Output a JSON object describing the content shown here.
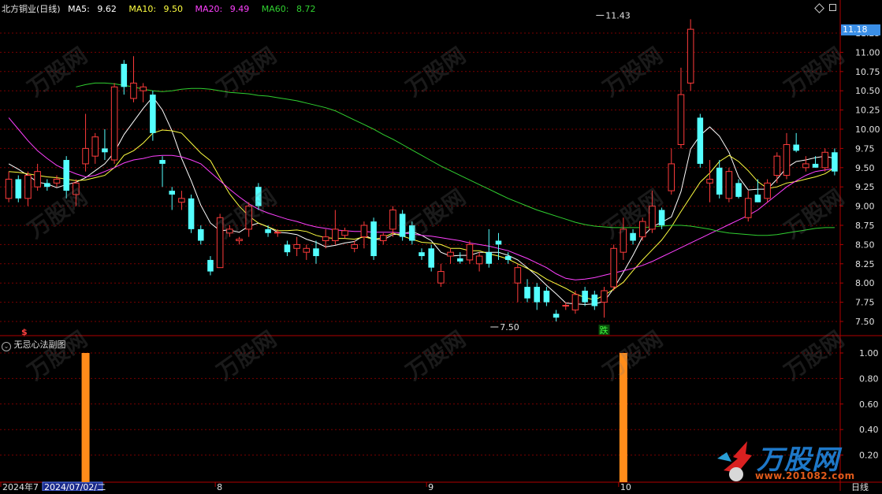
{
  "header": {
    "stock": "北方铜业(日线)",
    "ma5_label": "MA5:",
    "ma5": "9.62",
    "ma10_label": "MA10:",
    "ma10": "9.50",
    "ma20_label": "MA20:",
    "ma20": "9.49",
    "ma60_label": "MA60:",
    "ma60": "8.72"
  },
  "sub_header": {
    "title": "无忌心法副图"
  },
  "price_tag": "11.18",
  "period_label": "日线",
  "colors": {
    "up": "#ff3b3b",
    "down": "#54ffff",
    "ma5": "#ffffff",
    "ma10": "#ffff40",
    "ma20": "#ff40ff",
    "ma60": "#30d030",
    "grid": "#7a0000",
    "axis": "#b00000",
    "bar": "#ff8c1a",
    "tag": "#3a8ee6"
  },
  "icons": {
    "diamond": "diamond-icon",
    "settings": "gear-icon",
    "collapse": "chevron-down-icon"
  },
  "chart_data": [
    {
      "type": "candlestick",
      "title": "北方铜业(日线)",
      "ylim": [
        7.3,
        11.8
      ],
      "y_ticks": [
        "11.25",
        "11.00",
        "10.75",
        "10.50",
        "10.25",
        "10.00",
        "9.75",
        "9.50",
        "9.25",
        "9.00",
        "8.75",
        "8.50",
        "8.25",
        "8.00",
        "7.75",
        "7.50"
      ],
      "x_ticks": [
        {
          "label": "2024年7",
          "i": 0
        },
        {
          "label": "8",
          "i": 22
        },
        {
          "label": "9",
          "i": 44
        },
        {
          "label": "10",
          "i": 64
        }
      ],
      "cursor_date": "2024/07/02/二",
      "annotations": [
        {
          "text": "11.43",
          "i": 61,
          "value": 11.43
        },
        {
          "text": "7.50",
          "i": 50,
          "value": 7.5
        },
        {
          "text": "跌",
          "i": 62
        },
        {
          "text": "$",
          "i": 2
        }
      ],
      "candles": [
        {
          "o": 9.1,
          "h": 9.45,
          "l": 9.05,
          "c": 9.35
        },
        {
          "o": 9.35,
          "h": 9.4,
          "l": 9.05,
          "c": 9.1
        },
        {
          "o": 9.1,
          "h": 9.45,
          "l": 9.0,
          "c": 9.4
        },
        {
          "o": 9.25,
          "h": 9.55,
          "l": 9.2,
          "c": 9.45
        },
        {
          "o": 9.3,
          "h": 9.35,
          "l": 9.2,
          "c": 9.25
        },
        {
          "o": 9.3,
          "h": 9.4,
          "l": 9.25,
          "c": 9.35
        },
        {
          "o": 9.6,
          "h": 9.65,
          "l": 9.1,
          "c": 9.2
        },
        {
          "o": 9.15,
          "h": 9.35,
          "l": 9.0,
          "c": 9.3
        },
        {
          "o": 9.55,
          "h": 10.2,
          "l": 9.45,
          "c": 9.75
        },
        {
          "o": 9.65,
          "h": 9.95,
          "l": 9.55,
          "c": 9.9
        },
        {
          "o": 9.75,
          "h": 10.0,
          "l": 9.6,
          "c": 9.7
        },
        {
          "o": 9.6,
          "h": 10.6,
          "l": 9.55,
          "c": 10.55
        },
        {
          "o": 10.85,
          "h": 10.9,
          "l": 10.45,
          "c": 10.55
        },
        {
          "o": 10.4,
          "h": 10.95,
          "l": 10.35,
          "c": 10.6
        },
        {
          "o": 10.5,
          "h": 10.6,
          "l": 10.35,
          "c": 10.55
        },
        {
          "o": 10.45,
          "h": 10.5,
          "l": 9.85,
          "c": 9.95
        },
        {
          "o": 9.6,
          "h": 9.65,
          "l": 9.25,
          "c": 9.55
        },
        {
          "o": 9.2,
          "h": 9.25,
          "l": 8.95,
          "c": 9.15
        },
        {
          "o": 9.05,
          "h": 9.2,
          "l": 8.95,
          "c": 9.1
        },
        {
          "o": 9.1,
          "h": 9.15,
          "l": 8.65,
          "c": 8.7
        },
        {
          "o": 8.7,
          "h": 8.75,
          "l": 8.5,
          "c": 8.55
        },
        {
          "o": 8.3,
          "h": 8.35,
          "l": 8.1,
          "c": 8.15
        },
        {
          "o": 8.2,
          "h": 8.9,
          "l": 8.2,
          "c": 8.85
        },
        {
          "o": 8.65,
          "h": 8.75,
          "l": 8.6,
          "c": 8.7
        },
        {
          "o": 8.55,
          "h": 8.6,
          "l": 8.5,
          "c": 8.57
        },
        {
          "o": 8.7,
          "h": 9.05,
          "l": 8.6,
          "c": 9.0
        },
        {
          "o": 9.25,
          "h": 9.3,
          "l": 8.95,
          "c": 9.0
        },
        {
          "o": 8.7,
          "h": 8.75,
          "l": 8.6,
          "c": 8.65
        },
        {
          "o": 8.65,
          "h": 8.7,
          "l": 8.6,
          "c": 8.66
        },
        {
          "o": 8.5,
          "h": 8.55,
          "l": 8.35,
          "c": 8.4
        },
        {
          "o": 8.45,
          "h": 8.6,
          "l": 8.35,
          "c": 8.5
        },
        {
          "o": 8.4,
          "h": 8.5,
          "l": 8.3,
          "c": 8.45
        },
        {
          "o": 8.45,
          "h": 8.55,
          "l": 8.25,
          "c": 8.35
        },
        {
          "o": 8.55,
          "h": 8.7,
          "l": 8.45,
          "c": 8.6
        },
        {
          "o": 8.55,
          "h": 8.95,
          "l": 8.5,
          "c": 8.7
        },
        {
          "o": 8.62,
          "h": 8.72,
          "l": 8.58,
          "c": 8.68
        },
        {
          "o": 8.45,
          "h": 8.55,
          "l": 8.4,
          "c": 8.5
        },
        {
          "o": 8.6,
          "h": 8.8,
          "l": 8.45,
          "c": 8.75
        },
        {
          "o": 8.8,
          "h": 8.85,
          "l": 8.3,
          "c": 8.35
        },
        {
          "o": 8.55,
          "h": 8.65,
          "l": 8.5,
          "c": 8.62
        },
        {
          "o": 8.7,
          "h": 9.0,
          "l": 8.6,
          "c": 8.95
        },
        {
          "o": 8.9,
          "h": 8.95,
          "l": 8.55,
          "c": 8.6
        },
        {
          "o": 8.75,
          "h": 8.8,
          "l": 8.5,
          "c": 8.55
        },
        {
          "o": 8.4,
          "h": 8.45,
          "l": 8.3,
          "c": 8.35
        },
        {
          "o": 8.45,
          "h": 8.5,
          "l": 8.15,
          "c": 8.2
        },
        {
          "o": 8.0,
          "h": 8.25,
          "l": 7.95,
          "c": 8.15
        },
        {
          "o": 8.35,
          "h": 8.45,
          "l": 8.25,
          "c": 8.4
        },
        {
          "o": 8.32,
          "h": 8.4,
          "l": 8.25,
          "c": 8.28
        },
        {
          "o": 8.3,
          "h": 8.55,
          "l": 8.25,
          "c": 8.5
        },
        {
          "o": 8.25,
          "h": 8.4,
          "l": 8.15,
          "c": 8.35
        },
        {
          "o": 8.4,
          "h": 8.7,
          "l": 8.2,
          "c": 8.25
        },
        {
          "o": 8.55,
          "h": 8.65,
          "l": 8.3,
          "c": 8.5
        },
        {
          "o": 8.35,
          "h": 8.4,
          "l": 8.25,
          "c": 8.3
        },
        {
          "o": 8.0,
          "h": 8.25,
          "l": 7.75,
          "c": 8.2
        },
        {
          "o": 7.95,
          "h": 8.05,
          "l": 7.75,
          "c": 7.8
        },
        {
          "o": 7.95,
          "h": 8.0,
          "l": 7.65,
          "c": 7.75
        },
        {
          "o": 7.9,
          "h": 7.95,
          "l": 7.7,
          "c": 7.75
        },
        {
          "o": 7.6,
          "h": 7.65,
          "l": 7.5,
          "c": 7.55
        },
        {
          "o": 7.7,
          "h": 7.75,
          "l": 7.65,
          "c": 7.71
        },
        {
          "o": 7.65,
          "h": 7.9,
          "l": 7.6,
          "c": 7.85
        },
        {
          "o": 7.9,
          "h": 7.95,
          "l": 7.7,
          "c": 7.75
        },
        {
          "o": 7.85,
          "h": 7.9,
          "l": 7.65,
          "c": 7.7
        },
        {
          "o": 7.75,
          "h": 7.95,
          "l": 7.55,
          "c": 7.9
        },
        {
          "o": 7.95,
          "h": 8.5,
          "l": 7.9,
          "c": 8.45
        },
        {
          "o": 8.4,
          "h": 8.85,
          "l": 8.3,
          "c": 8.7
        },
        {
          "o": 8.65,
          "h": 8.7,
          "l": 8.5,
          "c": 8.55
        },
        {
          "o": 8.6,
          "h": 8.85,
          "l": 8.55,
          "c": 8.8
        },
        {
          "o": 8.7,
          "h": 9.2,
          "l": 8.65,
          "c": 9.0
        },
        {
          "o": 8.95,
          "h": 8.98,
          "l": 8.7,
          "c": 8.75
        },
        {
          "o": 9.2,
          "h": 9.75,
          "l": 9.15,
          "c": 9.55
        },
        {
          "o": 9.8,
          "h": 10.8,
          "l": 9.75,
          "c": 10.45
        },
        {
          "o": 10.6,
          "h": 11.43,
          "l": 10.5,
          "c": 11.3
        },
        {
          "o": 10.15,
          "h": 10.2,
          "l": 9.5,
          "c": 9.55
        },
        {
          "o": 9.3,
          "h": 9.6,
          "l": 9.05,
          "c": 9.35
        },
        {
          "o": 9.5,
          "h": 9.6,
          "l": 9.1,
          "c": 9.15
        },
        {
          "o": 9.1,
          "h": 9.5,
          "l": 9.05,
          "c": 9.45
        },
        {
          "o": 9.3,
          "h": 9.35,
          "l": 9.1,
          "c": 9.12
        },
        {
          "o": 8.85,
          "h": 9.2,
          "l": 8.8,
          "c": 9.1
        },
        {
          "o": 9.15,
          "h": 9.35,
          "l": 9.05,
          "c": 9.05
        },
        {
          "o": 9.1,
          "h": 9.35,
          "l": 9.05,
          "c": 9.3
        },
        {
          "o": 9.4,
          "h": 9.7,
          "l": 9.3,
          "c": 9.65
        },
        {
          "o": 9.4,
          "h": 9.95,
          "l": 9.35,
          "c": 9.8
        },
        {
          "o": 9.8,
          "h": 9.95,
          "l": 9.7,
          "c": 9.72
        },
        {
          "o": 9.5,
          "h": 9.65,
          "l": 9.45,
          "c": 9.55
        },
        {
          "o": 9.55,
          "h": 9.65,
          "l": 9.5,
          "c": 9.5
        },
        {
          "o": 9.5,
          "h": 9.75,
          "l": 9.45,
          "c": 9.7
        },
        {
          "o": 9.7,
          "h": 9.75,
          "l": 9.4,
          "c": 9.45
        }
      ],
      "ma_series": [
        {
          "name": "MA5",
          "values": [
            9.55,
            9.48,
            9.4,
            9.31,
            9.29,
            9.24,
            9.28,
            9.31,
            9.37,
            9.46,
            9.55,
            9.7,
            9.93,
            10.1,
            10.27,
            10.42,
            10.25,
            9.98,
            9.62,
            9.33,
            9.01,
            8.78,
            8.68,
            8.69,
            8.66,
            8.74,
            8.78,
            8.73,
            8.66,
            8.65,
            8.63,
            8.57,
            8.53,
            8.47,
            8.49,
            8.52,
            8.54,
            8.62,
            8.57,
            8.56,
            8.63,
            8.64,
            8.67,
            8.62,
            8.55,
            8.4,
            8.35,
            8.36,
            8.36,
            8.4,
            8.4,
            8.4,
            8.36,
            8.3,
            8.2,
            8.09,
            7.97,
            7.86,
            7.74,
            7.73,
            7.72,
            7.73,
            7.76,
            7.93,
            8.14,
            8.36,
            8.6,
            8.73,
            8.79,
            8.86,
            9.19,
            9.74,
            9.92,
            10.03,
            9.91,
            9.7,
            9.38,
            9.21,
            9.22,
            9.22,
            9.35,
            9.5,
            9.58,
            9.6,
            9.63,
            9.65,
            9.62
          ]
        },
        {
          "name": "MA10",
          "values": [
            9.45,
            9.44,
            9.42,
            9.4,
            9.38,
            9.37,
            9.35,
            9.33,
            9.34,
            9.37,
            9.4,
            9.5,
            9.66,
            9.72,
            9.82,
            9.95,
            9.99,
            9.98,
            9.95,
            9.82,
            9.69,
            9.59,
            9.37,
            9.16,
            9.0,
            8.87,
            8.78,
            8.73,
            8.68,
            8.68,
            8.69,
            8.67,
            8.62,
            8.59,
            8.58,
            8.58,
            8.57,
            8.6,
            8.57,
            8.59,
            8.65,
            8.61,
            8.57,
            8.53,
            8.52,
            8.5,
            8.45,
            8.45,
            8.42,
            8.42,
            8.38,
            8.35,
            8.31,
            8.25,
            8.19,
            8.13,
            8.05,
            7.99,
            7.93,
            7.86,
            7.81,
            7.78,
            7.84,
            7.92,
            8.01,
            8.16,
            8.3,
            8.43,
            8.56,
            8.73,
            8.93,
            9.12,
            9.31,
            9.43,
            9.58,
            9.66,
            9.58,
            9.46,
            9.32,
            9.23,
            9.25,
            9.3,
            9.32,
            9.35,
            9.38,
            9.42,
            9.5
          ]
        },
        {
          "name": "MA20",
          "values": [
            10.15,
            10.0,
            9.85,
            9.72,
            9.62,
            9.53,
            9.47,
            9.42,
            9.38,
            9.4,
            9.45,
            9.5,
            9.56,
            9.6,
            9.62,
            9.65,
            9.66,
            9.66,
            9.64,
            9.6,
            9.55,
            9.44,
            9.33,
            9.22,
            9.12,
            9.03,
            8.96,
            8.91,
            8.87,
            8.83,
            8.8,
            8.76,
            8.73,
            8.71,
            8.69,
            8.68,
            8.67,
            8.67,
            8.66,
            8.66,
            8.66,
            8.65,
            8.64,
            8.62,
            8.61,
            8.59,
            8.57,
            8.55,
            8.52,
            8.5,
            8.48,
            8.45,
            8.42,
            8.37,
            8.32,
            8.26,
            8.2,
            8.12,
            8.06,
            8.04,
            8.05,
            8.07,
            8.1,
            8.13,
            8.16,
            8.19,
            8.23,
            8.28,
            8.34,
            8.4,
            8.46,
            8.52,
            8.58,
            8.64,
            8.7,
            8.76,
            8.82,
            8.88,
            8.95,
            9.05,
            9.15,
            9.25,
            9.33,
            9.4,
            9.45,
            9.47,
            9.49
          ]
        },
        {
          "name": "MA60",
          "values": [
            10.55,
            10.58,
            10.6,
            10.6,
            10.59,
            10.57,
            10.55,
            10.52,
            10.5,
            10.49,
            10.5,
            10.52,
            10.53,
            10.53,
            10.52,
            10.5,
            10.48,
            10.47,
            10.46,
            10.44,
            10.43,
            10.41,
            10.39,
            10.37,
            10.34,
            10.31,
            10.28,
            10.24,
            10.18,
            10.12,
            10.06,
            10.0,
            9.93,
            9.87,
            9.8,
            9.73,
            9.66,
            9.59,
            9.52,
            9.46,
            9.4,
            9.34,
            9.28,
            9.22,
            9.16,
            9.1,
            9.05,
            9.0,
            8.95,
            8.91,
            8.87,
            8.83,
            8.79,
            8.76,
            8.74,
            8.73,
            8.72,
            8.72,
            8.72,
            8.72,
            8.73,
            8.74,
            8.75,
            8.75,
            8.74,
            8.72,
            8.7,
            8.67,
            8.65,
            8.64,
            8.63,
            8.62,
            8.62,
            8.63,
            8.65,
            8.67,
            8.69,
            8.71,
            8.72,
            8.72
          ]
        }
      ]
    },
    {
      "type": "bar",
      "title": "无忌心法副图",
      "ylim": [
        0,
        1.0
      ],
      "y_ticks": [
        "1.00",
        "0.80",
        "0.60",
        "0.40",
        "0.20"
      ],
      "signals": [
        {
          "i": 8,
          "value": 1.0
        },
        {
          "i": 64,
          "value": 1.0
        }
      ]
    }
  ],
  "watermark_text": "万股网",
  "watermark_url": "www.201082.com",
  "brand": {
    "name": "万股网",
    "url": "www.201082.com"
  }
}
